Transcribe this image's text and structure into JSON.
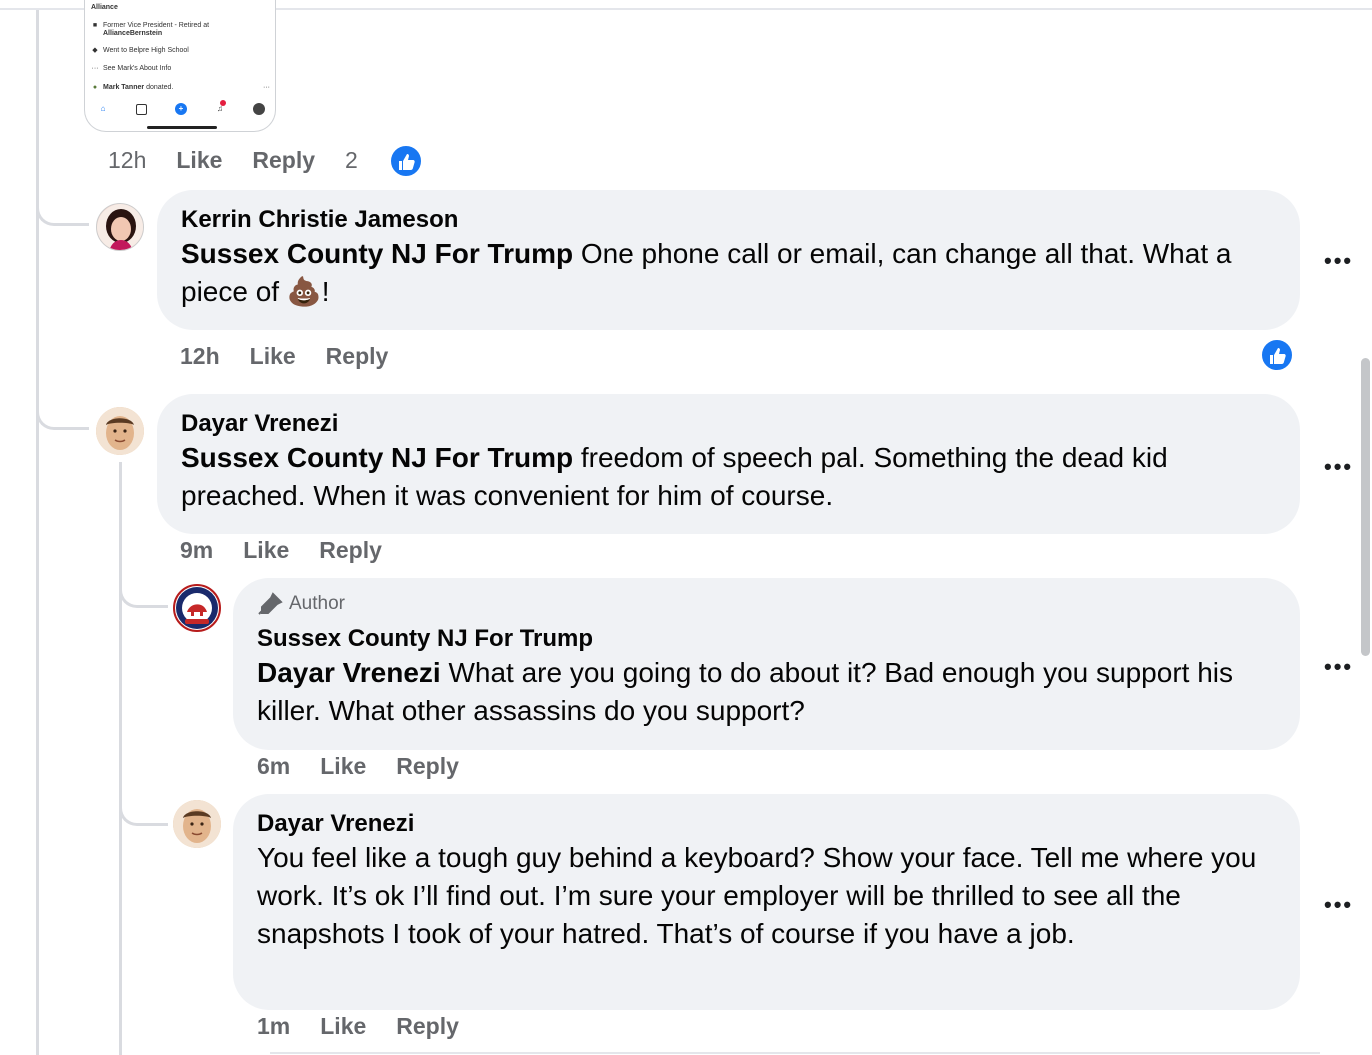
{
  "screenshot": {
    "header_text": "Alliance",
    "rows": [
      {
        "icon": "briefcase-icon",
        "text": "Former Vice President - Retired at",
        "bold": "AllianceBernstein"
      },
      {
        "icon": "graduation-cap-icon",
        "text": "Went to Belpre High School",
        "bold": ""
      },
      {
        "icon": "ellipsis-icon",
        "text": "See Mark's About Info",
        "bold": ""
      },
      {
        "icon": "avatar-icon",
        "text": "donated.",
        "bold": "Mark Tanner"
      }
    ]
  },
  "comments": [
    {
      "time": "12h",
      "like": "Like",
      "reply": "Reply",
      "reaction_count": "2"
    },
    {
      "author": "Kerrin Christie Jameson",
      "tag": "Sussex County NJ For Trump",
      "body": " One phone call or email, can change all that. What a piece of 💩!",
      "time": "12h",
      "like": "Like",
      "reply": "Reply"
    },
    {
      "author": "Dayar Vrenezi",
      "tag": "Sussex County NJ For Trump",
      "body": " freedom of speech pal. Something the dead kid preached. When it was convenient for him of course.",
      "time": "9m",
      "like": "Like",
      "reply": "Reply"
    },
    {
      "badge": "Author",
      "author": "Sussex County NJ For Trump",
      "tag": "Dayar Vrenezi",
      "body": " What are you going to do about it? Bad enough you support his killer. What other assassins do you support?",
      "time": "6m",
      "like": "Like",
      "reply": "Reply"
    },
    {
      "author": "Dayar Vrenezi",
      "body": "You feel like a tough guy behind a keyboard? Show your face. Tell me where you work. It’s ok I’ll find out. I’m sure your employer will be thrilled to see all the snapshots I took of your hatred. That’s of course if you have a job.",
      "time": "1m",
      "like": "Like",
      "reply": "Reply"
    }
  ],
  "more_label": "•••",
  "colors": {
    "accent": "#1877f2",
    "bubble": "#f0f2f5",
    "meta": "#65676b",
    "text": "#050505"
  }
}
